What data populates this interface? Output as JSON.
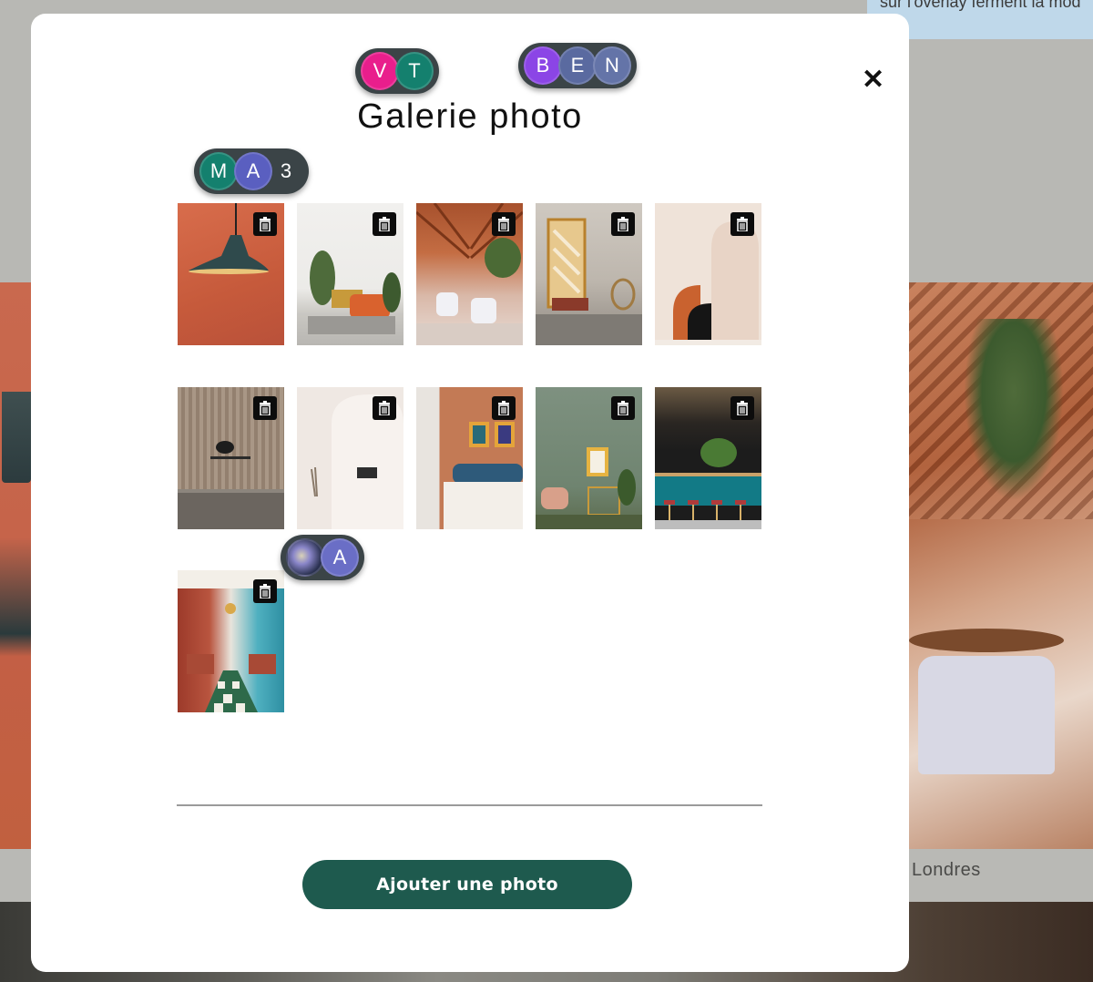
{
  "background": {
    "overlay_note": "sur l'overlay ferment la mod",
    "caption": "Londres"
  },
  "modal": {
    "title": "Galerie photo",
    "close_label": "✕",
    "add_button_label": "Ajouter une photo"
  },
  "presence": [
    {
      "avatars": [
        {
          "label": "V",
          "color": "#e91e8c"
        },
        {
          "label": "T",
          "color": "#14806e"
        }
      ]
    },
    {
      "avatars": [
        {
          "label": "B",
          "color": "#8b45e6"
        },
        {
          "label": "E",
          "color": "#5a6aa0"
        },
        {
          "label": "N",
          "color": "#6474a8"
        }
      ]
    },
    {
      "avatars": [
        {
          "label": "M",
          "color": "#14806e"
        },
        {
          "label": "A",
          "color": "#5a5fc0"
        },
        {
          "label": "3",
          "color": "transparent"
        }
      ]
    },
    {
      "avatars": [
        {
          "label": "",
          "color": "#2a3150",
          "image": "planet-avatar"
        },
        {
          "label": "A",
          "color": "#6a6ec6"
        }
      ]
    }
  ],
  "gallery": {
    "photos": [
      {
        "subject": "terracotta wall with pendant lamp"
      },
      {
        "subject": "living room with orange armchair and plants"
      },
      {
        "subject": "restaurant with wooden slatted ceiling"
      },
      {
        "subject": "sunlit room with hanging chair"
      },
      {
        "subject": "minimal arches in beige and terracotta"
      },
      {
        "subject": "wood panel kitchen with wall light"
      },
      {
        "subject": "white arched hallway with sofa"
      },
      {
        "subject": "terracotta bedroom with portraits"
      },
      {
        "subject": "sage green room with portrait"
      },
      {
        "subject": "teal bar counter with red stools"
      },
      {
        "subject": "long dining hall with checkered floor"
      }
    ],
    "delete_icon": "trash-icon"
  }
}
